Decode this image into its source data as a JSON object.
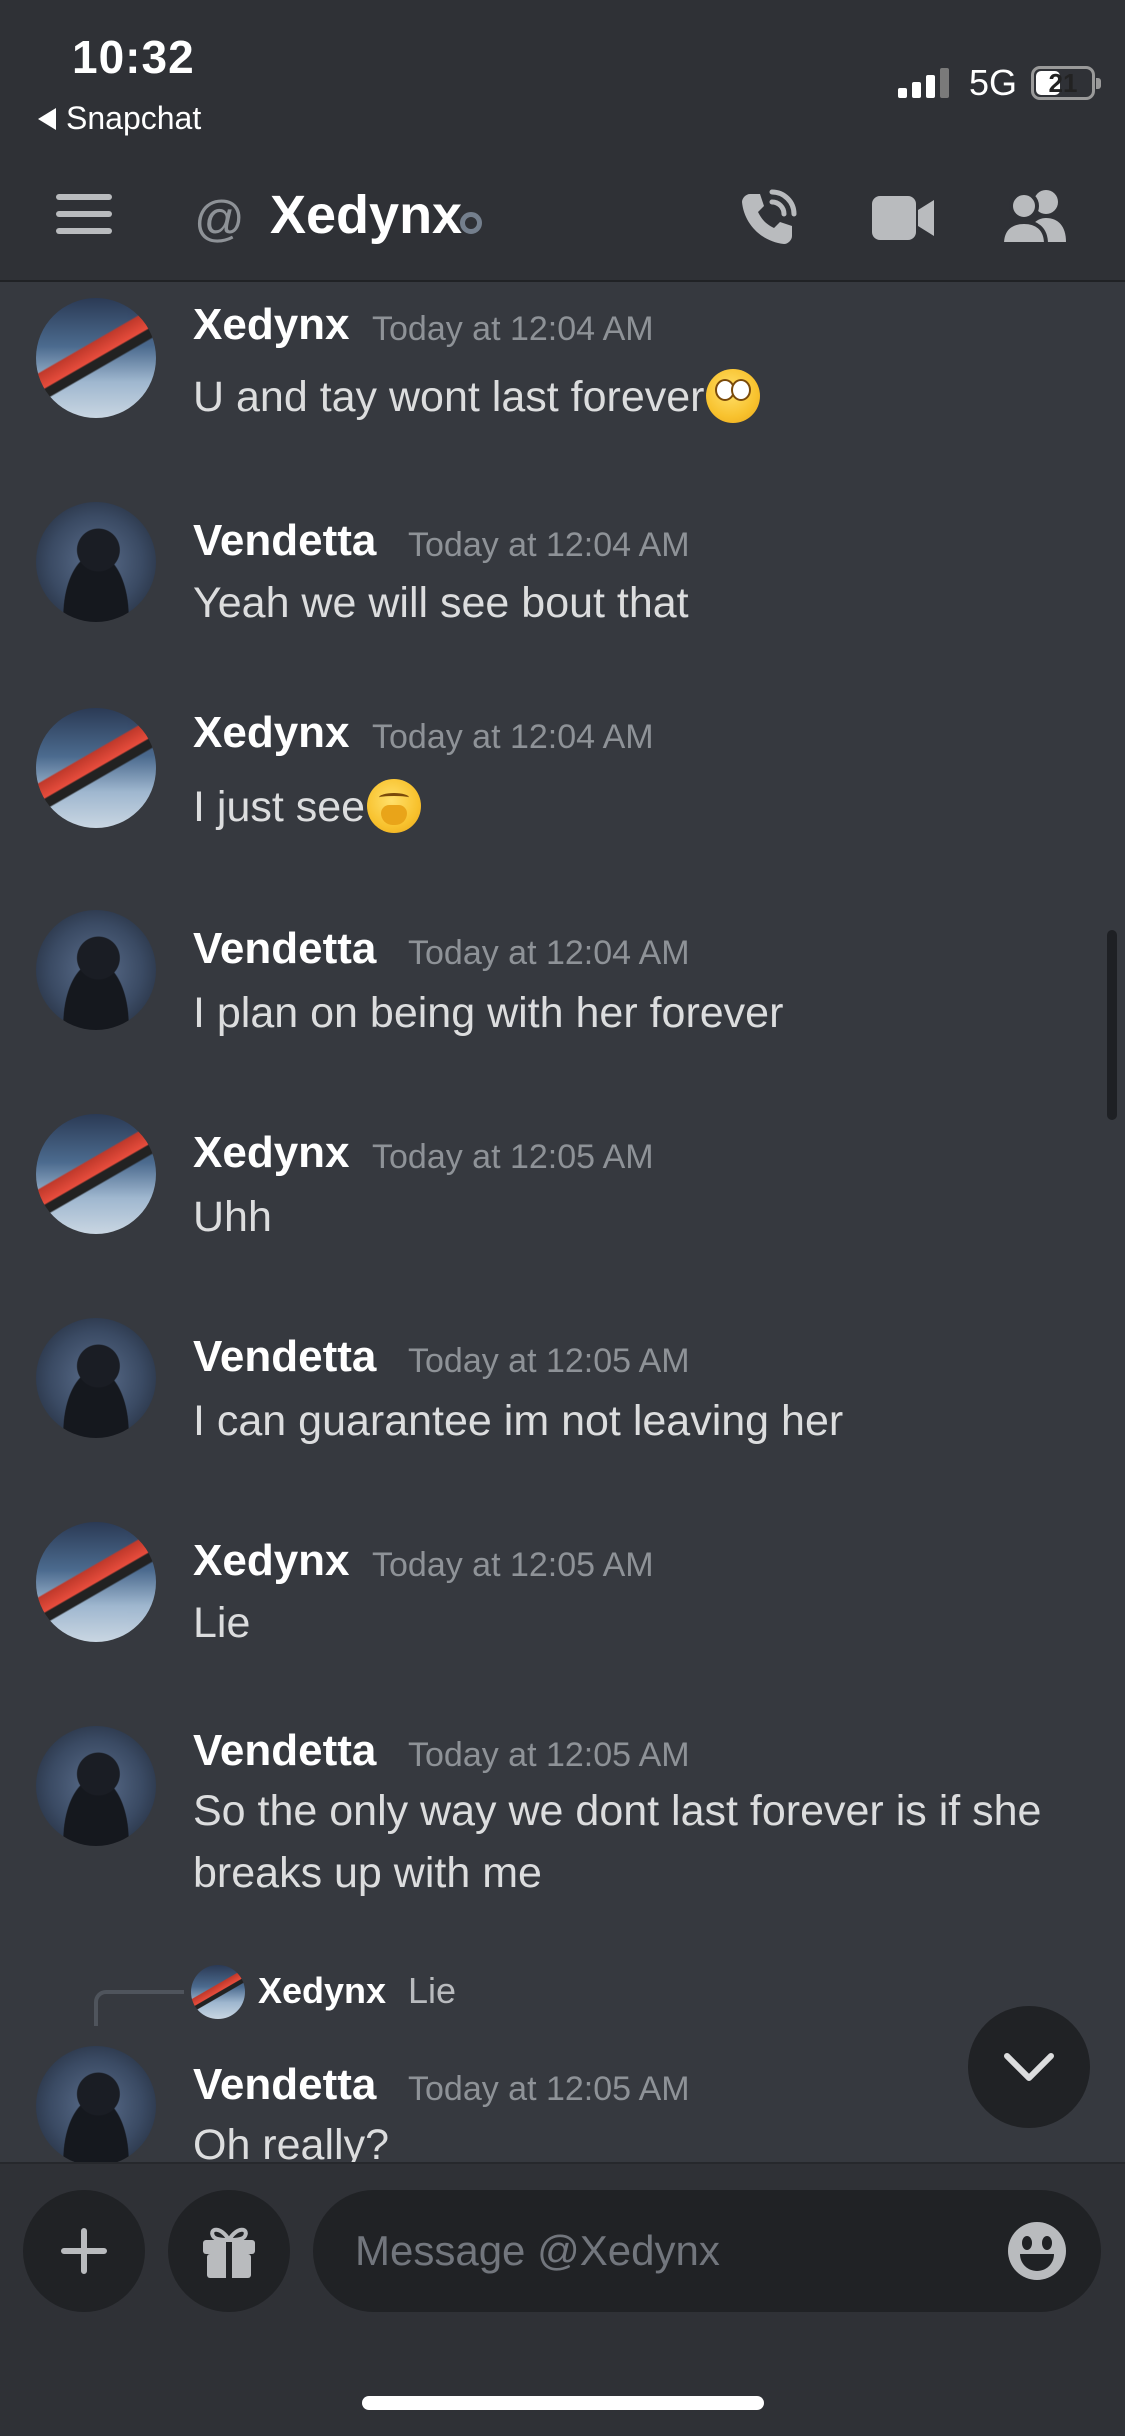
{
  "status_bar": {
    "time": "10:32",
    "back_app": "Snapchat",
    "network": "5G",
    "battery": "21"
  },
  "header": {
    "at_symbol": "@",
    "title": "Xedynx",
    "presence": "offline",
    "icons": [
      "menu-icon",
      "call-icon",
      "video-icon",
      "members-icon"
    ]
  },
  "messages": [
    {
      "author": "Xedynx",
      "timestamp": "Today at 12:04 AM",
      "text": "U and tay wont last forever",
      "emoji": "face-with-rolling-eyes"
    },
    {
      "author": "Vendetta",
      "timestamp": "Today at 12:04 AM",
      "text": "Yeah we will see bout that"
    },
    {
      "author": "Xedynx",
      "timestamp": "Today at 12:04 AM",
      "text": "I just see",
      "emoji": "yawning-face"
    },
    {
      "author": "Vendetta",
      "timestamp": "Today at 12:04 AM",
      "text": "I plan on being with her forever"
    },
    {
      "author": "Xedynx",
      "timestamp": "Today at 12:05 AM",
      "text": "Uhh"
    },
    {
      "author": "Vendetta",
      "timestamp": "Today at 12:05 AM",
      "text": "I can guarantee im not leaving her"
    },
    {
      "author": "Xedynx",
      "timestamp": "Today at 12:05 AM",
      "text": "Lie"
    },
    {
      "author": "Vendetta",
      "timestamp": "Today at 12:05 AM",
      "text_line1": "So the only way we dont last forever is if she",
      "text_line2": "breaks up with me"
    },
    {
      "author": "Vendetta",
      "timestamp": "Today at 12:05 AM",
      "text": "Oh really?",
      "reply_to": {
        "author": "Xedynx",
        "text": "Lie"
      }
    }
  ],
  "composer": {
    "placeholder": "Message @Xedynx",
    "value": ""
  },
  "colors": {
    "background": "#36393f",
    "header_bg": "#2f3136",
    "input_bg": "#202225",
    "muted_text": "#8e9297"
  }
}
